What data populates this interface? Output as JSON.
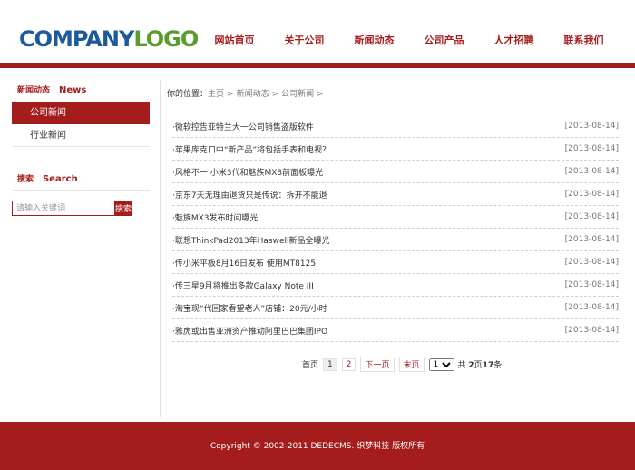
{
  "logo": {
    "company": "COMPANY",
    "logo": "LOGO"
  },
  "nav": [
    "网站首页",
    "关于公司",
    "新闻动态",
    "公司产品",
    "人才招聘",
    "联系我们"
  ],
  "sidebar": {
    "title_cn": "新闻动态",
    "title_en": "News",
    "items": [
      "公司新闻",
      "行业新闻"
    ],
    "search_cn": "搜索",
    "search_en": "Search",
    "search_placeholder": "请输入关键词",
    "search_button": "搜索"
  },
  "breadcrumb": {
    "lead": "你的位置：",
    "items": [
      "主页",
      "新闻动态",
      "公司新闻"
    ],
    "separator": ">"
  },
  "news": [
    {
      "title": "·微软控告亚特兰大一公司销售盗版软件",
      "date": "[2013-08-14]"
    },
    {
      "title": "·苹果库克口中“新产品”将包括手表和电视？",
      "date": "[2013-08-14]"
    },
    {
      "title": "·风格不一 小米3代和魅族MX3前面板曝光",
      "date": "[2013-08-14]"
    },
    {
      "title": "·京东7天无理由退货只是传说：拆开不能退",
      "date": "[2013-08-14]"
    },
    {
      "title": "·魅族MX3发布时间曝光",
      "date": "[2013-08-14]"
    },
    {
      "title": "·联想ThinkPad2013年Haswell新品全曝光",
      "date": "[2013-08-14]"
    },
    {
      "title": "·传小米平板8月16日发布 使用MT8125",
      "date": "[2013-08-14]"
    },
    {
      "title": "·传三星9月将推出多款Galaxy Note III",
      "date": "[2013-08-14]"
    },
    {
      "title": "·淘宝现“代回家看望老人”店铺：20元/小时",
      "date": "[2013-08-14]"
    },
    {
      "title": "·雅虎或出售亚洲资产推动阿里巴巴集团IPO",
      "date": "[2013-08-14]"
    }
  ],
  "pager": {
    "first": "首页",
    "page1": "1",
    "page2": "2",
    "next": "下一页",
    "last": "末页",
    "select_value": "1",
    "total_prefix": "共",
    "total_pages": "2",
    "pages_word": "页",
    "total_items": "17",
    "items_word": "条"
  },
  "footer": {
    "copyright": "Copyright © 2002-2011 DEDECMS. 织梦科技 版权所有"
  },
  "colors": {
    "brand_red": "#a51c1c",
    "logo_blue": "#1d5a9a",
    "logo_green": "#5c9c2c"
  }
}
